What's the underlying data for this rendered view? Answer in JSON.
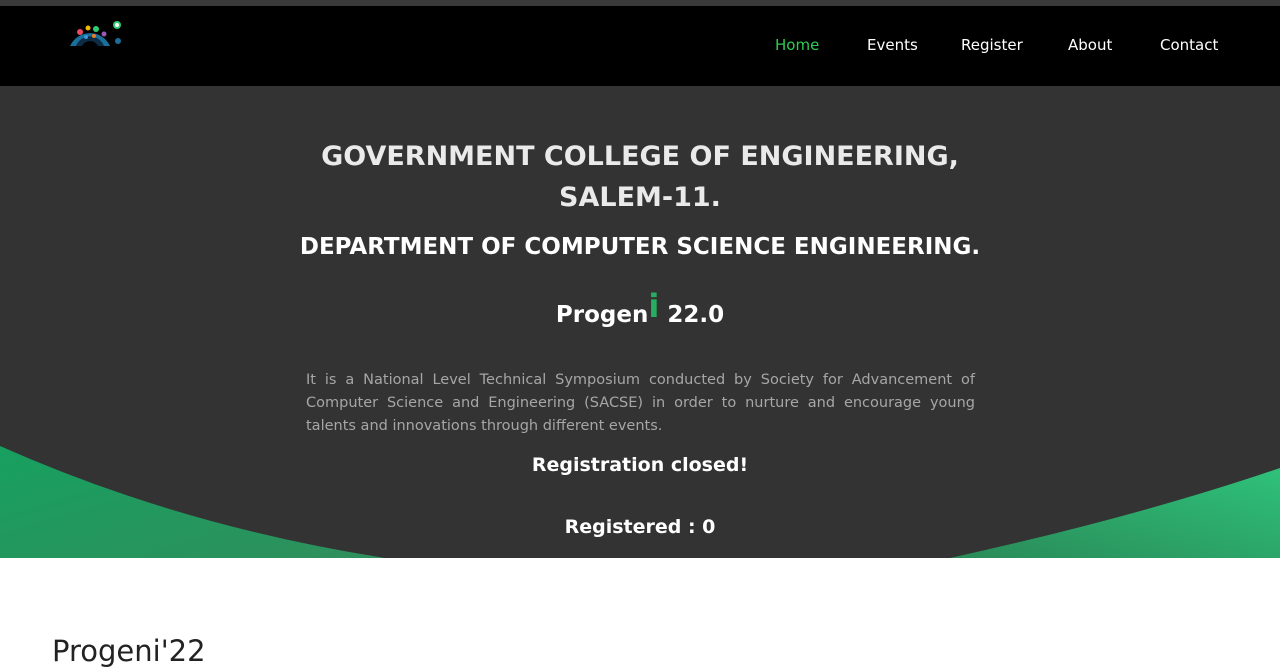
{
  "nav": {
    "logo": "progeni-logo",
    "items": [
      {
        "label": "Home",
        "active": true
      },
      {
        "label": "Events",
        "active": false
      },
      {
        "label": "Register",
        "active": false
      },
      {
        "label": "About",
        "active": false
      },
      {
        "label": "Contact",
        "active": false
      }
    ]
  },
  "hero": {
    "title_line1": "GOVERNMENT COLLEGE OF ENGINEERING,",
    "title_line2": "SALEM-11.",
    "department": "DEPARTMENT OF COMPUTER SCIENCE ENGINEERING.",
    "brand": {
      "prefix": "Progen",
      "accent": "i",
      "suffix": " 22.0"
    },
    "description": "It is a National Level Technical Symposium conducted by Society for Advancement of Computer Science and Engineering (SACSE) in order to nurture and encourage young talents and innovations through different events.",
    "registration_status": "Registration closed!",
    "registered_label": "Registered : 0"
  },
  "section": {
    "heading": "Progeni'22"
  },
  "colors": {
    "nav_bg": "#000000",
    "nav_active": "#2ecc52",
    "hero_bg": "#333333",
    "accent_green": "#27ae60",
    "wave_green": "#2ebf6f"
  }
}
